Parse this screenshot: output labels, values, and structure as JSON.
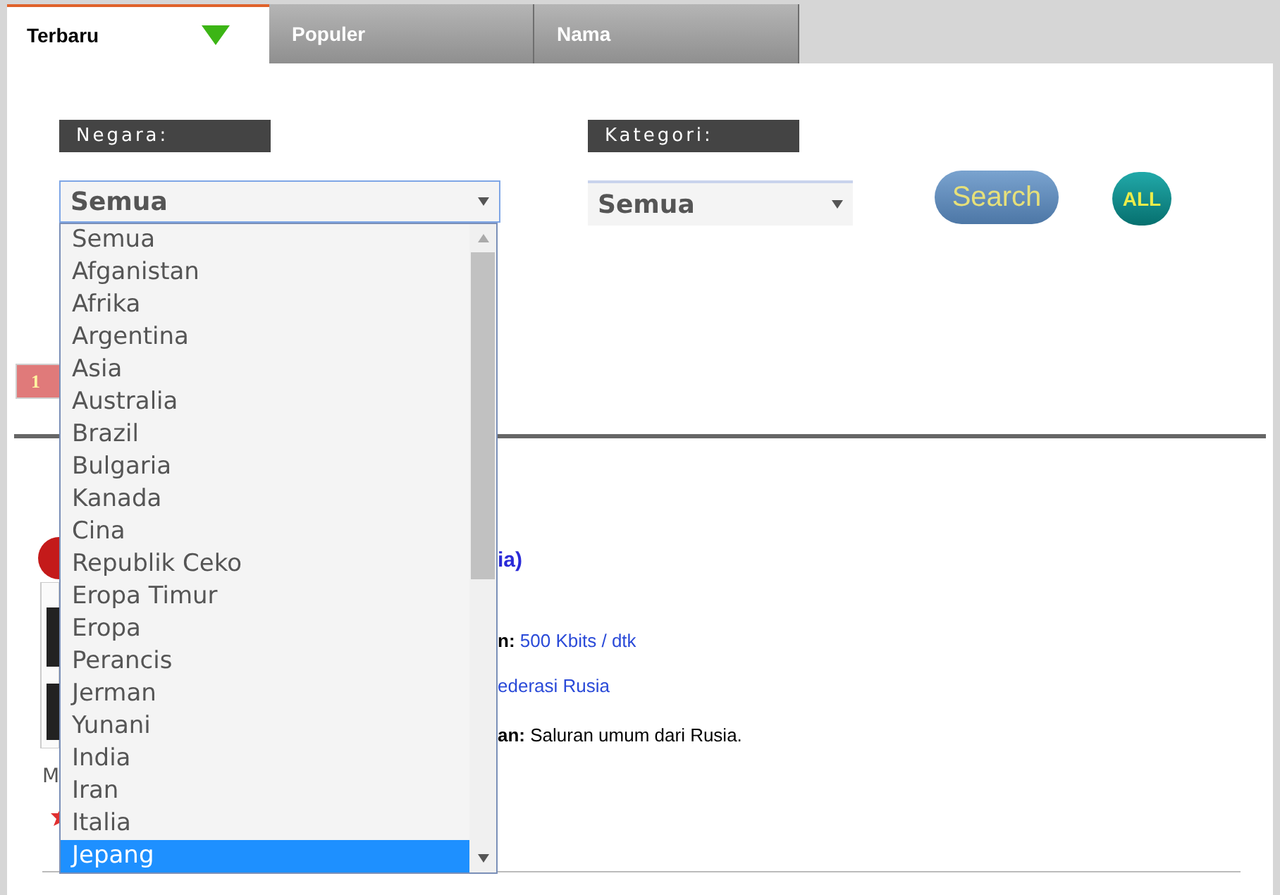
{
  "tabs": [
    {
      "label": "Terbaru",
      "selected": true
    },
    {
      "label": "Populer",
      "selected": false
    },
    {
      "label": "Nama",
      "selected": false
    }
  ],
  "filters": {
    "negara": {
      "label": "Negara:",
      "value": "Semua"
    },
    "kategori": {
      "label": "Kategori:",
      "value": "Semua"
    }
  },
  "buttons": [
    "Search",
    "ALL"
  ],
  "pagination": [
    "1"
  ],
  "station": {
    "title": "ia)",
    "speed_label": "n:",
    "speed": "500 Kbits / dtk",
    "country": "ederasi Rusia",
    "description_label": "an:",
    "description": "Saluran umum dari Rusia.",
    "caption": "M"
  },
  "dropdown": {
    "items": [
      {
        "label": "Semua",
        "selected": false
      },
      {
        "label": "Afganistan",
        "selected": false
      },
      {
        "label": "Afrika",
        "selected": false
      },
      {
        "label": "Argentina",
        "selected": false
      },
      {
        "label": "Asia",
        "selected": false
      },
      {
        "label": "Australia",
        "selected": false
      },
      {
        "label": "Brazil",
        "selected": false
      },
      {
        "label": "Bulgaria",
        "selected": false
      },
      {
        "label": "Kanada",
        "selected": false
      },
      {
        "label": "Cina",
        "selected": false
      },
      {
        "label": "Republik Ceko",
        "selected": false
      },
      {
        "label": "Eropa Timur",
        "selected": false
      },
      {
        "label": "Eropa",
        "selected": false
      },
      {
        "label": "Perancis",
        "selected": false
      },
      {
        "label": "Jerman",
        "selected": false
      },
      {
        "label": "Yunani",
        "selected": false
      },
      {
        "label": "India",
        "selected": false
      },
      {
        "label": "Iran",
        "selected": false
      },
      {
        "label": "Italia",
        "selected": false
      },
      {
        "label": "Jepang",
        "selected": true
      }
    ]
  }
}
